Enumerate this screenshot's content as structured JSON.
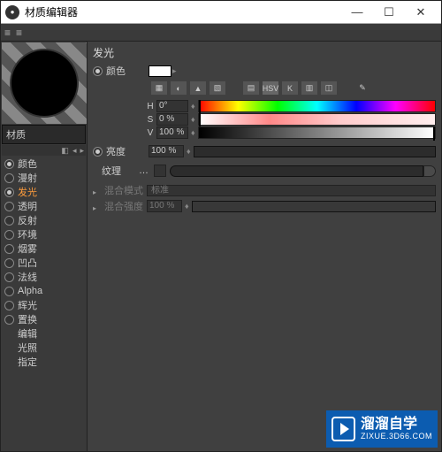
{
  "titlebar": {
    "title": "材质编辑器"
  },
  "sidebar": {
    "material_label": "材质",
    "channels": [
      {
        "label": "颜色",
        "checked": true,
        "active": false,
        "hasCheckbox": true
      },
      {
        "label": "漫射",
        "checked": false,
        "active": false,
        "hasCheckbox": true
      },
      {
        "label": "发光",
        "checked": true,
        "active": true,
        "hasCheckbox": true
      },
      {
        "label": "透明",
        "checked": false,
        "active": false,
        "hasCheckbox": true
      },
      {
        "label": "反射",
        "checked": false,
        "active": false,
        "hasCheckbox": true
      },
      {
        "label": "环境",
        "checked": false,
        "active": false,
        "hasCheckbox": true
      },
      {
        "label": "烟雾",
        "checked": false,
        "active": false,
        "hasCheckbox": true
      },
      {
        "label": "凹凸",
        "checked": false,
        "active": false,
        "hasCheckbox": true
      },
      {
        "label": "法线",
        "checked": false,
        "active": false,
        "hasCheckbox": true
      },
      {
        "label": "Alpha",
        "checked": false,
        "active": false,
        "hasCheckbox": true
      },
      {
        "label": "辉光",
        "checked": false,
        "active": false,
        "hasCheckbox": true
      },
      {
        "label": "置换",
        "checked": false,
        "active": false,
        "hasCheckbox": true
      },
      {
        "label": "编辑",
        "checked": false,
        "active": false,
        "hasCheckbox": false
      },
      {
        "label": "光照",
        "checked": false,
        "active": false,
        "hasCheckbox": false
      },
      {
        "label": "指定",
        "checked": false,
        "active": false,
        "hasCheckbox": false
      }
    ]
  },
  "panel": {
    "title": "发光",
    "color_label": "颜色",
    "hsv_btn": "HSV",
    "h": {
      "label": "H",
      "value": "0°"
    },
    "s": {
      "label": "S",
      "value": "0 %"
    },
    "v": {
      "label": "V",
      "value": "100 %"
    },
    "brightness_label": "亮度",
    "brightness_value": "100 %",
    "texture_label": "纹理",
    "blend_mode_label": "混合模式",
    "blend_mode_value": "标准",
    "blend_strength_label": "混合强度",
    "blend_strength_value": "100 %"
  },
  "watermark": {
    "big": "溜溜自学",
    "small": "ZIXUE.3D66.COM"
  }
}
